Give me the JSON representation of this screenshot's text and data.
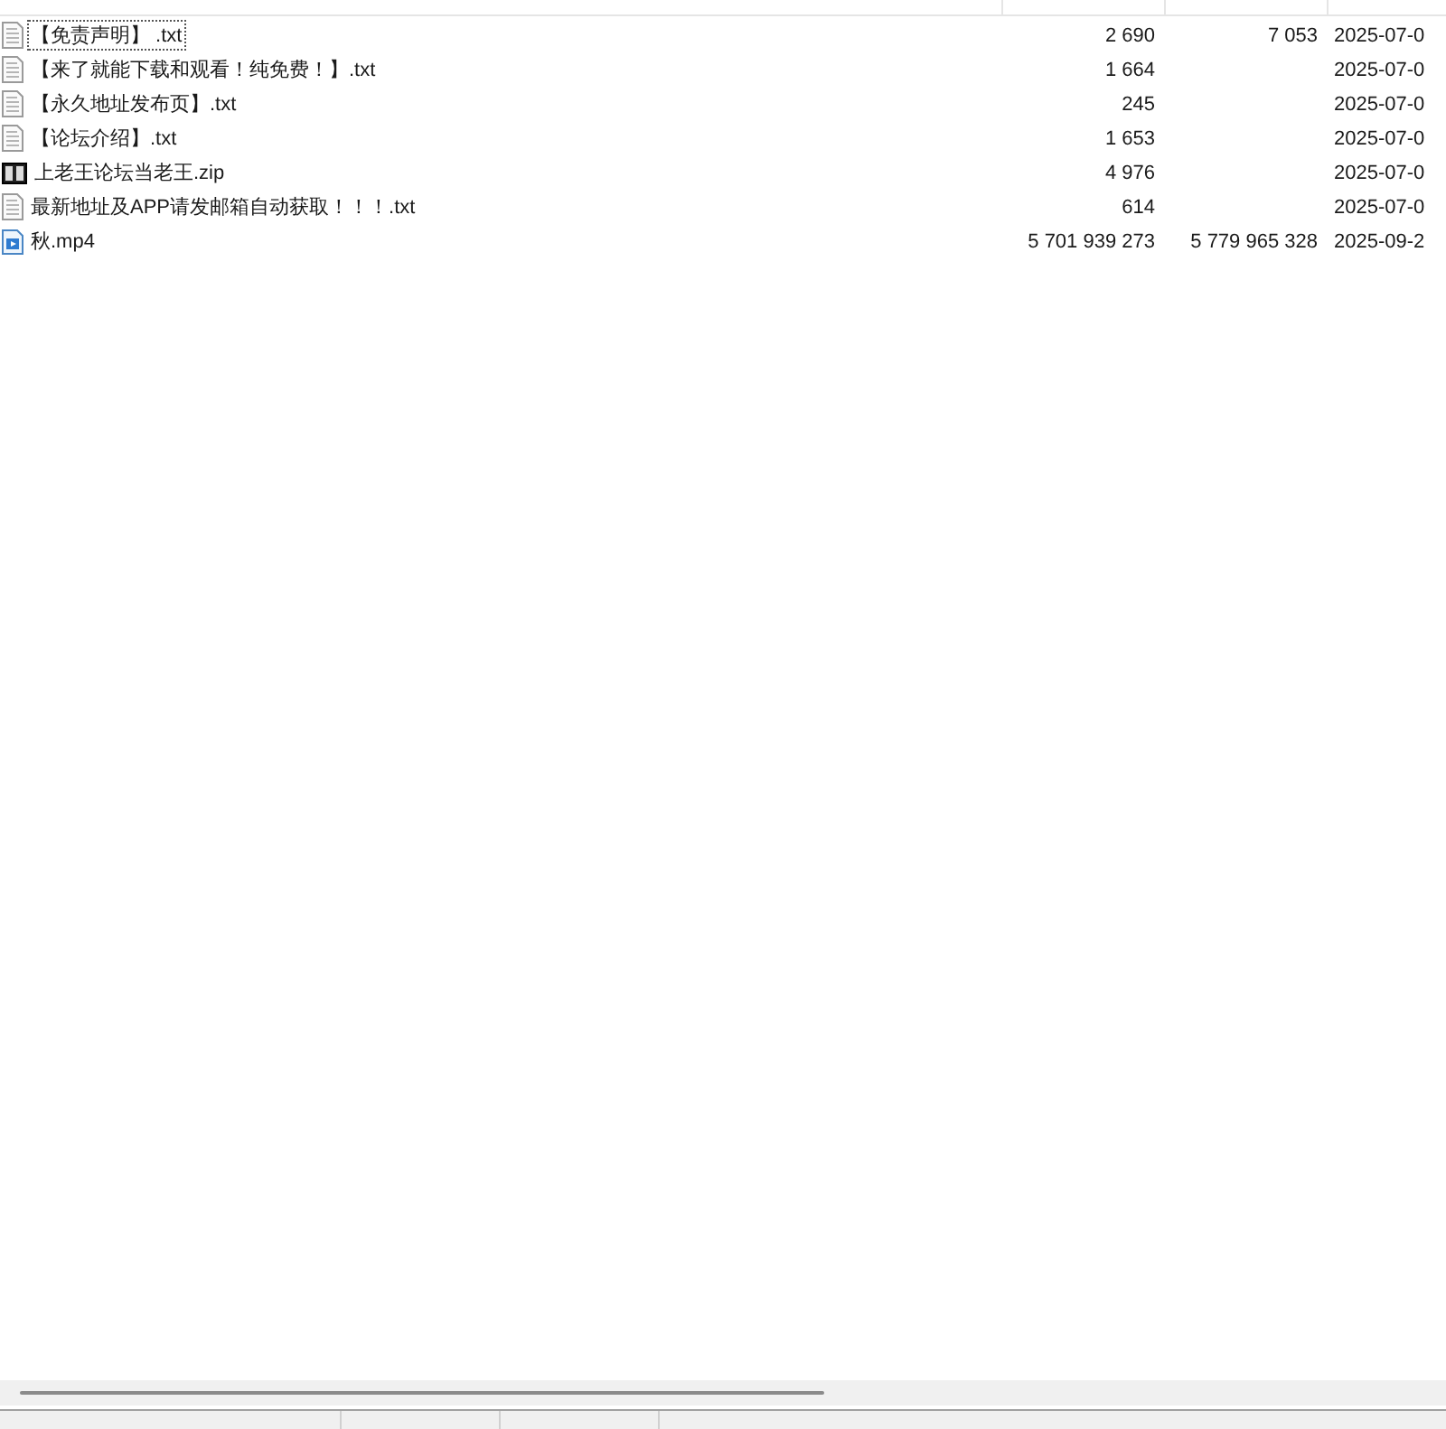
{
  "file_list": {
    "rows": [
      {
        "kind": "text",
        "name": "【免责声明】 .txt",
        "size": "2 690",
        "packed_size": "7 053",
        "modified": "2025-07-0",
        "focused": true
      },
      {
        "kind": "text",
        "name": "【来了就能下载和观看！纯免费！】.txt",
        "size": "1 664",
        "packed_size": "",
        "modified": "2025-07-0",
        "focused": false
      },
      {
        "kind": "text",
        "name": "【永久地址发布页】.txt",
        "size": "245",
        "packed_size": "",
        "modified": "2025-07-0",
        "focused": false
      },
      {
        "kind": "text",
        "name": "【论坛介绍】.txt",
        "size": "1 653",
        "packed_size": "",
        "modified": "2025-07-0",
        "focused": false
      },
      {
        "kind": "archive",
        "name": "上老王论坛当老王.zip",
        "size": "4 976",
        "packed_size": "",
        "modified": "2025-07-0",
        "focused": false
      },
      {
        "kind": "text",
        "name": "最新地址及APP请发邮箱自动获取！！！.txt",
        "size": "614",
        "packed_size": "",
        "modified": "2025-07-0",
        "focused": false
      },
      {
        "kind": "video",
        "name": "秋.mp4",
        "size": "5 701 939 273",
        "packed_size": "5 779 965 328",
        "modified": "2025-09-2",
        "focused": false
      }
    ]
  }
}
